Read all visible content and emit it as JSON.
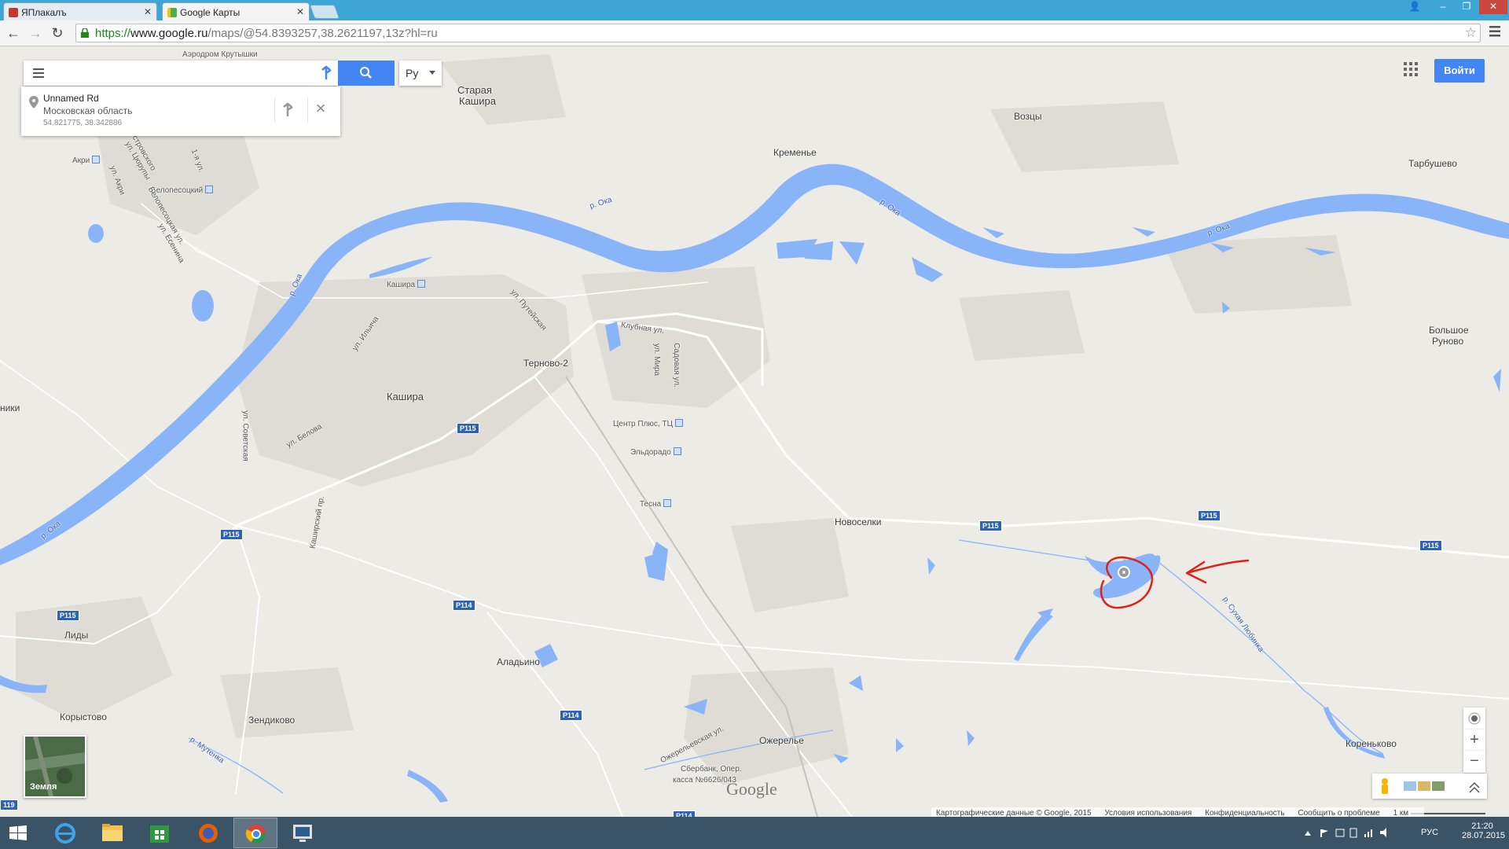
{
  "browser": {
    "tabs": [
      {
        "title": "ЯПлакалъ",
        "active": false
      },
      {
        "title": "Google Карты",
        "active": true
      }
    ],
    "url_https": "https://",
    "url_host": "www.google.ru",
    "url_rest": "/maps/@54.8393257,38.2621197,13z?hl=ru"
  },
  "search": {
    "placeholder": "",
    "lang_label": "Ру"
  },
  "result_card": {
    "name": "Unnamed Rd",
    "region": "Московская область",
    "coords": "54.821775, 38.342886"
  },
  "header": {
    "login_label": "Войти"
  },
  "earth_label": "Земля",
  "map_labels": {
    "aerodrom": "Аэродром Крутышки",
    "staraya_kashira_1": "Старая",
    "staraya_kashira_2": "Кашира",
    "voztsy": "Возцы",
    "kremenye": "Кременье",
    "tarbushevo": "Тарбушево",
    "akri": "Акри",
    "belopestotsky": "Белопесоцкий",
    "kashira_station": "Кашира",
    "kashira": "Кашира",
    "ternovo": "Терново-2",
    "klubnaya": "Клубная ул.",
    "centr_plus": "Центр Плюс, ТЦ",
    "eldorado": "Эльдорадо",
    "tesna": "Тесна",
    "novoselki": "Новоселки",
    "bolshoe_runovo_1": "Большое",
    "bolshoe_runovo_2": "Руново",
    "lidy": "Лиды",
    "aladino": "Аладьино",
    "korystovo": "Корыстово",
    "zendikovo": "Зендиково",
    "ozherelye": "Ожерелье",
    "sberbank_1": "Сбербанк, Опер.",
    "sberbank_2": "касса №6626/043",
    "korenkovo": "Кореньково",
    "niki": "ники",
    "ul_putevaya": "ул. Путейская",
    "ul_ilyicha": "ул. Ильича",
    "ul_belova": "ул. Белова",
    "ul_sovetskaya": "ул. Советская",
    "kashirsky_pr": "Каширский пр.",
    "ul_mira": "ул. Мира",
    "sadovaya": "Садовая ул.",
    "ozherelyevskaya": "Ожерельевская ул.",
    "ul_ostrovskogo": "ул. Островского",
    "ul_akri": "ул. Акри",
    "ul_tsurupy": "ул. Цюрупы",
    "ul_esenina": "ул. Есенина",
    "belopesotskaya_ul": "Белопесоцкая ул.",
    "first_ul": "1-я ул.",
    "river_oka_1": "р. Ока",
    "river_oka_2": "р. Ока",
    "river_oka_3": "р. Ока",
    "river_oka_4": "р. Ока",
    "river_oka_5": "р. Ока",
    "river_sukhaya": "р. Сухая Любинка",
    "river_mutenka": "р. Мутенка"
  },
  "road_shields": {
    "p115_a": "P115",
    "p115_b": "P115",
    "p115_c": "P115",
    "p115_d": "P115",
    "p115_e": "P115",
    "p115_f": "P115",
    "p114_a": "P114",
    "p114_b": "P114",
    "p114_c": "P114",
    "edge_119": "119"
  },
  "footer": {
    "map_data": "Картографические данные © Google, 2015",
    "terms": "Условия использования",
    "privacy": "Конфиденциальность",
    "report": "Сообщить о проблеме",
    "scale": "1 км"
  },
  "google_logo": "Google",
  "taskbar": {
    "lang": "РУС",
    "time": "21:20",
    "date": "28.07.2015"
  },
  "colors": {
    "water": "#8ab4f8",
    "land": "#ecebe6",
    "accent": "#4285f4",
    "annotation": "#e0201b",
    "taskbar": "#3b5366",
    "tab_strip": "#3da6d6"
  }
}
